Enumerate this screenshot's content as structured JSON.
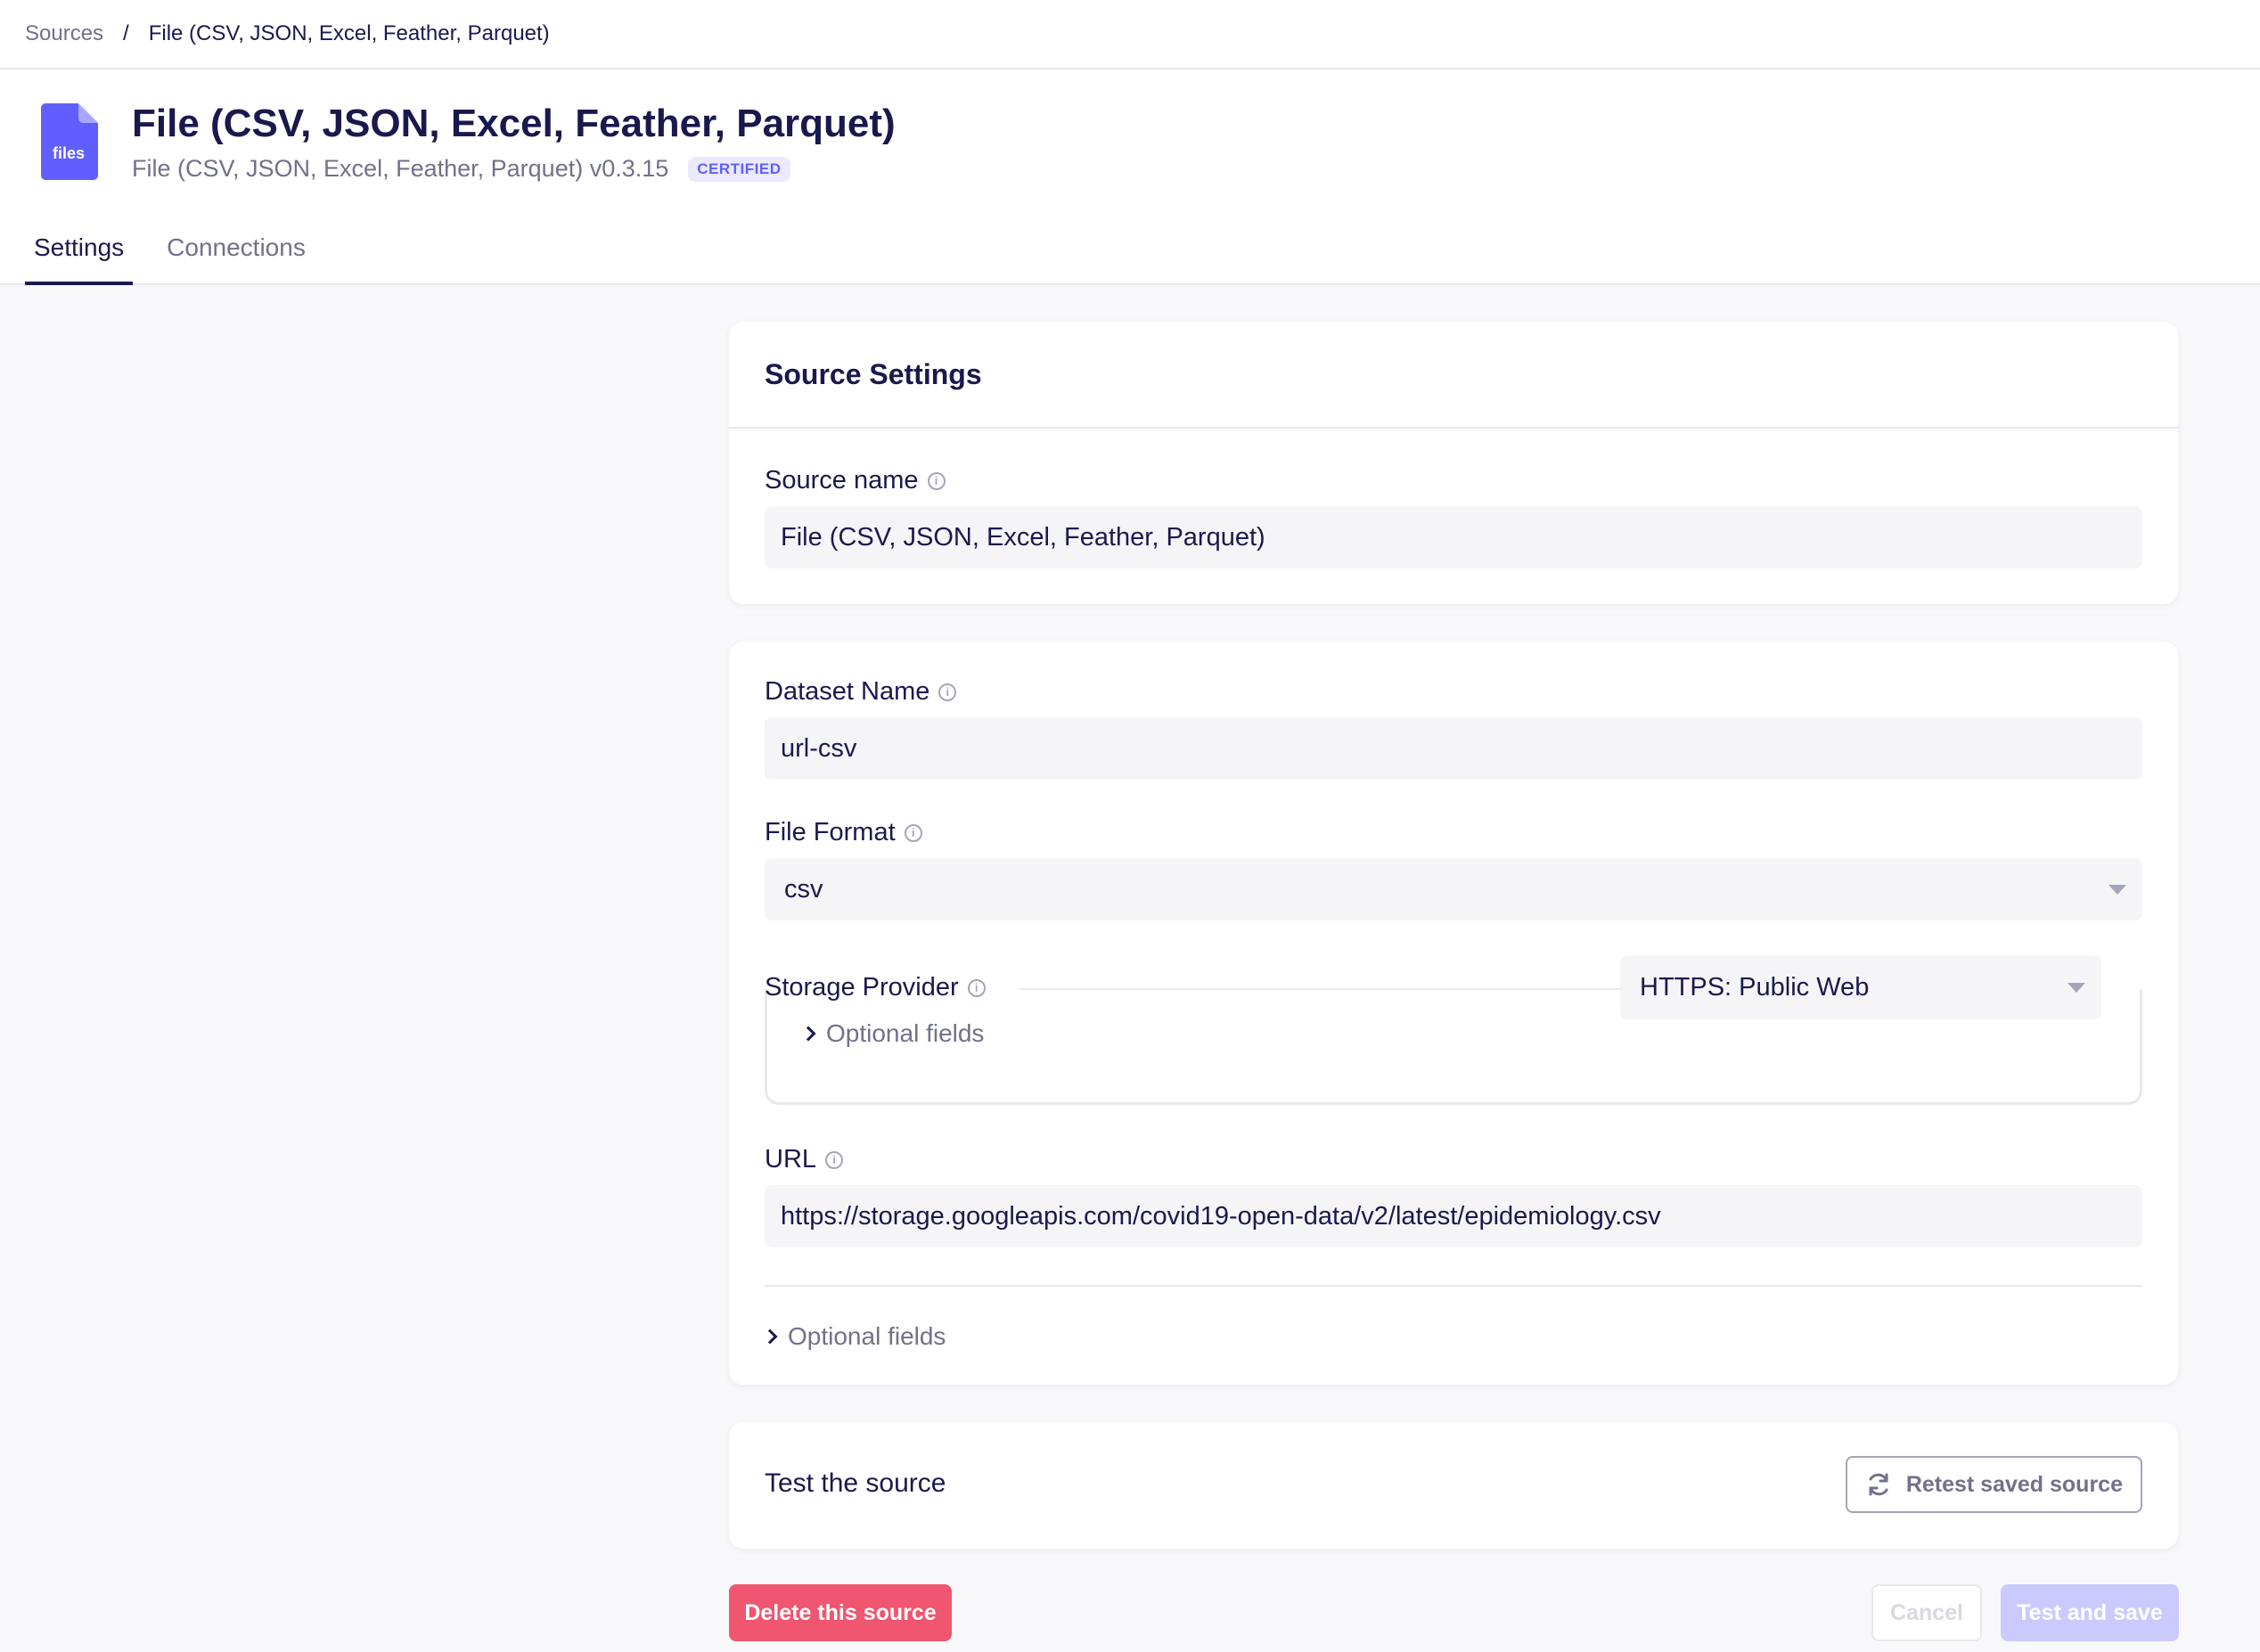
{
  "breadcrumb": {
    "parent": "Sources",
    "separator": "/",
    "current": "File (CSV, JSON, Excel, Feather, Parquet)"
  },
  "header": {
    "icon_text": "files",
    "title": "File (CSV, JSON, Excel, Feather, Parquet)",
    "subtitle": "File (CSV, JSON, Excel, Feather, Parquet) v0.3.15",
    "badge": "CERTIFIED"
  },
  "tabs": [
    {
      "label": "Settings",
      "active": true
    },
    {
      "label": "Connections",
      "active": false
    }
  ],
  "source_settings": {
    "title": "Source Settings",
    "source_name_label": "Source name",
    "source_name_value": "File (CSV, JSON, Excel, Feather, Parquet)"
  },
  "config": {
    "dataset_name_label": "Dataset Name",
    "dataset_name_value": "url-csv",
    "file_format_label": "File Format",
    "file_format_value": "csv",
    "storage_provider_label": "Storage Provider",
    "storage_provider_value": "HTTPS: Public Web",
    "storage_optional_label": "Optional fields",
    "url_label": "URL",
    "url_value": "https://storage.googleapis.com/covid19-open-data/v2/latest/epidemiology.csv",
    "optional_label": "Optional fields"
  },
  "test": {
    "title": "Test the source",
    "retest_label": "Retest saved source"
  },
  "actions": {
    "delete_label": "Delete this source",
    "cancel_label": "Cancel",
    "save_label": "Test and save"
  },
  "colors": {
    "brand": "#615eff",
    "danger": "#f0566f",
    "text": "#1a194d"
  }
}
